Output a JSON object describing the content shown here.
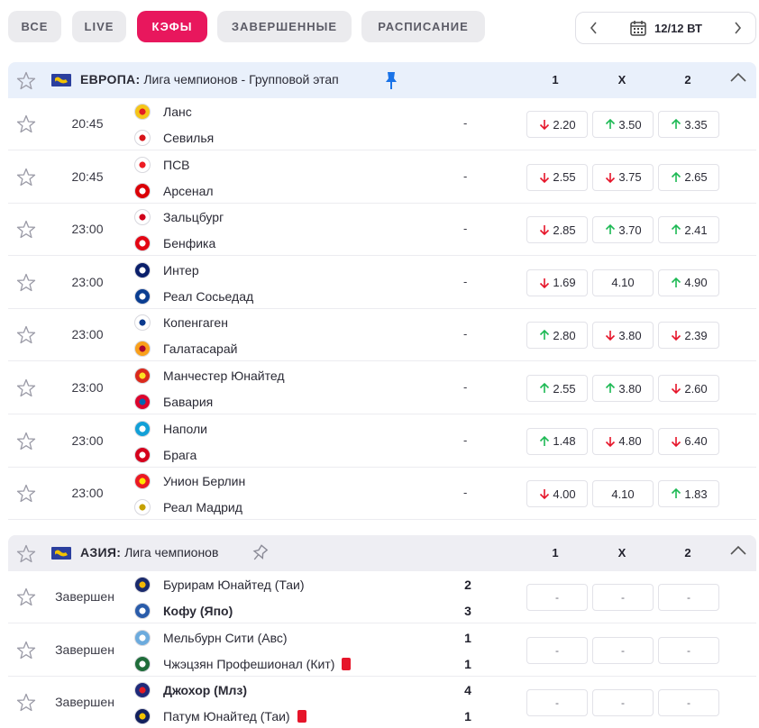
{
  "tabs": [
    {
      "label": "ВСЕ",
      "active": false
    },
    {
      "label": "LIVE",
      "active": false
    },
    {
      "label": "КЭФЫ",
      "active": true
    },
    {
      "label": "ЗАВЕРШЕННЫЕ",
      "active": false
    },
    {
      "label": "РАСПИСАНИЕ",
      "active": false
    }
  ],
  "date": {
    "label": "12/12 ВТ",
    "icon": "calendar-icon"
  },
  "colors": {
    "accent": "#e8175d",
    "up": "#1db954",
    "down": "#e6152a"
  },
  "leagues": [
    {
      "region": "ЕВРОПА:",
      "name": "Лига чемпионов - Групповой этап",
      "pinned": true,
      "cols": [
        "1",
        "X",
        "2"
      ],
      "matches": [
        {
          "time": "20:45",
          "home": "Ланс",
          "away": "Севилья",
          "dash": "-",
          "odds": [
            {
              "v": "2.20",
              "dir": "down"
            },
            {
              "v": "3.50",
              "dir": "up"
            },
            {
              "v": "3.35",
              "dir": "up"
            }
          ]
        },
        {
          "time": "20:45",
          "home": "ПСВ",
          "away": "Арсенал",
          "dash": "-",
          "odds": [
            {
              "v": "2.55",
              "dir": "down"
            },
            {
              "v": "3.75",
              "dir": "down"
            },
            {
              "v": "2.65",
              "dir": "up"
            }
          ]
        },
        {
          "time": "23:00",
          "home": "Зальцбург",
          "away": "Бенфика",
          "dash": "-",
          "odds": [
            {
              "v": "2.85",
              "dir": "down"
            },
            {
              "v": "3.70",
              "dir": "up"
            },
            {
              "v": "2.41",
              "dir": "up"
            }
          ]
        },
        {
          "time": "23:00",
          "home": "Интер",
          "away": "Реал Сосьедад",
          "dash": "-",
          "odds": [
            {
              "v": "1.69",
              "dir": "down"
            },
            {
              "v": "4.10",
              "dir": "none"
            },
            {
              "v": "4.90",
              "dir": "up"
            }
          ]
        },
        {
          "time": "23:00",
          "home": "Копенгаген",
          "away": "Галатасарай",
          "dash": "-",
          "odds": [
            {
              "v": "2.80",
              "dir": "up"
            },
            {
              "v": "3.80",
              "dir": "down"
            },
            {
              "v": "2.39",
              "dir": "down"
            }
          ]
        },
        {
          "time": "23:00",
          "home": "Манчестер Юнайтед",
          "away": "Бавария",
          "dash": "-",
          "odds": [
            {
              "v": "2.55",
              "dir": "up"
            },
            {
              "v": "3.80",
              "dir": "up"
            },
            {
              "v": "2.60",
              "dir": "down"
            }
          ]
        },
        {
          "time": "23:00",
          "home": "Наполи",
          "away": "Брага",
          "dash": "-",
          "odds": [
            {
              "v": "1.48",
              "dir": "up"
            },
            {
              "v": "4.80",
              "dir": "down"
            },
            {
              "v": "6.40",
              "dir": "down"
            }
          ]
        },
        {
          "time": "23:00",
          "home": "Унион Берлин",
          "away": "Реал Мадрид",
          "dash": "-",
          "odds": [
            {
              "v": "4.00",
              "dir": "down"
            },
            {
              "v": "4.10",
              "dir": "none"
            },
            {
              "v": "1.83",
              "dir": "up"
            }
          ]
        }
      ]
    },
    {
      "region": "АЗИЯ:",
      "name": "Лига чемпионов",
      "pinned": false,
      "cols": [
        "1",
        "X",
        "2"
      ],
      "matches": [
        {
          "status": "Завершен",
          "home": "Бурирам Юнайтед (Таи)",
          "away": "Кофу (Япо)",
          "home_score": "2",
          "away_score": "3",
          "winner": "away",
          "odds": [
            "-",
            "-",
            "-"
          ]
        },
        {
          "status": "Завершен",
          "home": "Мельбурн Сити (Авс)",
          "away": "Чжэцзян Профешионал (Кит)",
          "home_score": "1",
          "away_score": "1",
          "away_red": true,
          "odds": [
            "-",
            "-",
            "-"
          ]
        },
        {
          "status": "Завершен",
          "home": "Джохор (Млз)",
          "away": "Патум Юнайтед (Таи)",
          "home_score": "4",
          "away_score": "1",
          "winner": "home",
          "away_red": true,
          "odds": [
            "-",
            "-",
            "-"
          ]
        }
      ]
    }
  ]
}
